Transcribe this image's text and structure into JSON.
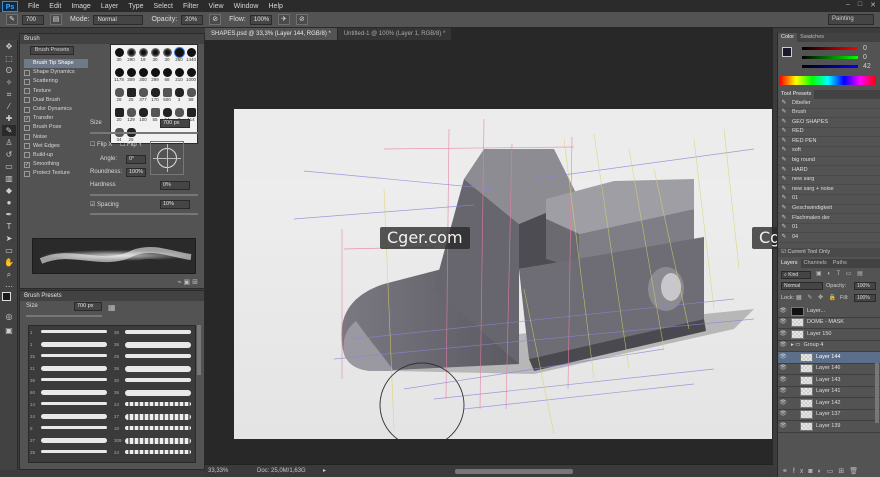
{
  "app": {
    "logo": "Ps"
  },
  "menu": [
    "File",
    "Edit",
    "Image",
    "Layer",
    "Type",
    "Select",
    "Filter",
    "View",
    "Window",
    "Help"
  ],
  "window_controls": {
    "minimize": "–",
    "maximize": "□",
    "close": "✕"
  },
  "options": {
    "brush_size": "700",
    "mode_label": "Mode:",
    "mode_value": "Normal",
    "opacity_label": "Opacity:",
    "opacity_value": "20%",
    "flow_label": "Flow:",
    "flow_value": "100%",
    "workspace": "Painting"
  },
  "tabs": [
    {
      "label": "SHAPES.psd @ 33,3% (Layer 144, RGB/8) *",
      "active": true
    },
    {
      "label": "Untitled-1 @ 100% (Layer 1, RGB/8) *",
      "active": false
    }
  ],
  "brush_panel": {
    "tabs": [
      "Brush",
      "Brush Presets"
    ],
    "presets_button": "Brush Presets",
    "options": [
      {
        "label": "Brush Tip Shape",
        "checked": null,
        "selected": true
      },
      {
        "label": "Shape Dynamics",
        "checked": false
      },
      {
        "label": "Scattering",
        "checked": false
      },
      {
        "label": "Texture",
        "checked": false
      },
      {
        "label": "Dual Brush",
        "checked": false
      },
      {
        "label": "Color Dynamics",
        "checked": false
      },
      {
        "label": "Transfer",
        "checked": true
      },
      {
        "label": "Brush Pose",
        "checked": false
      },
      {
        "label": "Noise",
        "checked": false
      },
      {
        "label": "Wet Edges",
        "checked": false
      },
      {
        "label": "Build-up",
        "checked": false
      },
      {
        "label": "Smoothing",
        "checked": true
      },
      {
        "label": "Protect Texture",
        "checked": false
      }
    ],
    "tip_sizes": [
      "30",
      "290",
      "19",
      "30",
      "30",
      "250",
      "1440",
      "1178",
      "309",
      "300",
      "299",
      "68",
      "210",
      "1000",
      "28",
      "25",
      "377",
      "170",
      "500",
      "3",
      "59",
      "20",
      "129",
      "100",
      "55",
      "64",
      "3",
      "114",
      "34",
      "25"
    ],
    "size_label": "Size",
    "size_value": "700 px",
    "flip_x": "Flip X",
    "flip_y": "Flip Y",
    "angle_label": "Angle:",
    "angle_value": "0°",
    "roundness_label": "Roundness:",
    "roundness_value": "100%",
    "hardness_label": "Hardness",
    "hardness_value": "0%",
    "spacing_label": "Spacing",
    "spacing_value": "10%"
  },
  "brush_presets_panel": {
    "title": "Brush Presets",
    "size_label": "Size",
    "size_value": "700 px",
    "stroke_numbers": [
      "1",
      "36",
      "1",
      "36",
      "25",
      "25",
      "21",
      "36",
      "36",
      "30",
      "60",
      "36",
      "14",
      "24",
      "24",
      "27",
      "8",
      "10",
      "27",
      "309",
      "28",
      "24"
    ]
  },
  "right_panel": {
    "color_tabs": [
      "Color",
      "Swatches"
    ],
    "rgb": {
      "r": "0",
      "g": "0",
      "b": "42"
    },
    "tool_presets_title": "Tool Presets",
    "tool_presets": [
      "Dibeller",
      "Brush",
      "GEO SHAPES",
      "RED",
      "RED PEN",
      "soft",
      "big round",
      "HARD",
      "new sarg",
      "new sarg + noise",
      "01",
      "Geschwindigkeit",
      "Flachmalen der",
      "01",
      "04"
    ],
    "current_tool_only": "Current Tool Only",
    "layers_tabs": [
      "Layers",
      "Channels",
      "Paths"
    ],
    "kind_label": "Kind",
    "blend_mode": "Normal",
    "opacity_label": "Opacity:",
    "opacity_value": "100%",
    "lock_label": "Lock:",
    "fill_label": "Fill:",
    "fill_value": "100%",
    "layers": [
      {
        "name": "Layer...",
        "thumb": "dark",
        "selected": false
      },
      {
        "name": "DOME - MASK",
        "thumb": "light",
        "selected": false
      },
      {
        "name": "Layer 150",
        "thumb": "light",
        "selected": false
      },
      {
        "name": "Group 4",
        "thumb": "folder",
        "selected": false
      },
      {
        "name": "Layer 144",
        "thumb": "light",
        "selected": true
      },
      {
        "name": "Layer 146",
        "thumb": "light",
        "selected": false
      },
      {
        "name": "Layer 143",
        "thumb": "light",
        "selected": false
      },
      {
        "name": "Layer 141",
        "thumb": "light",
        "selected": false
      },
      {
        "name": "Layer 142",
        "thumb": "light",
        "selected": false
      },
      {
        "name": "Layer 137",
        "thumb": "light",
        "selected": false
      },
      {
        "name": "Layer 139",
        "thumb": "light",
        "selected": false
      }
    ]
  },
  "status": {
    "zoom": "33,33%",
    "doc": "Doc: 25,0M/1,63G"
  },
  "watermarks": [
    "Cger.com",
    "Cger.com"
  ]
}
